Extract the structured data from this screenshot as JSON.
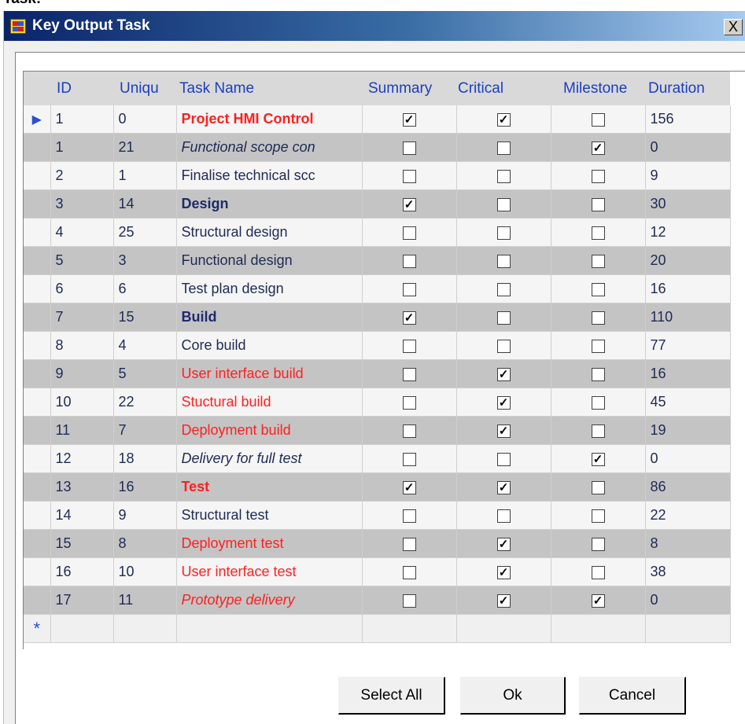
{
  "caption": "Task:",
  "window": {
    "title": "Key Output Task",
    "close_label": "X"
  },
  "grid": {
    "columns": [
      "ID",
      "Uniqu",
      "Task Name",
      "Summary",
      "Critical",
      "Milestone",
      "Duration"
    ],
    "current_row_marker": "▶",
    "new_row_marker": "*",
    "rows": [
      {
        "id": "1",
        "uid": "0",
        "name": "Project HMI Control",
        "style": "bold-red",
        "summary": true,
        "critical": true,
        "milestone": false,
        "duration": "156"
      },
      {
        "id": "1",
        "uid": "21",
        "name": "Functional scope con",
        "style": "italic",
        "summary": false,
        "critical": false,
        "milestone": true,
        "duration": "0"
      },
      {
        "id": "2",
        "uid": "1",
        "name": "Finalise technical scc",
        "style": "normal",
        "summary": false,
        "critical": false,
        "milestone": false,
        "duration": "9"
      },
      {
        "id": "3",
        "uid": "14",
        "name": "Design",
        "style": "bold-blue",
        "summary": true,
        "critical": false,
        "milestone": false,
        "duration": "30"
      },
      {
        "id": "4",
        "uid": "25",
        "name": "Structural design",
        "style": "normal",
        "summary": false,
        "critical": false,
        "milestone": false,
        "duration": "12"
      },
      {
        "id": "5",
        "uid": "3",
        "name": "Functional design",
        "style": "normal",
        "summary": false,
        "critical": false,
        "milestone": false,
        "duration": "20"
      },
      {
        "id": "6",
        "uid": "6",
        "name": "Test plan design",
        "style": "normal",
        "summary": false,
        "critical": false,
        "milestone": false,
        "duration": "16"
      },
      {
        "id": "7",
        "uid": "15",
        "name": "Build",
        "style": "bold-blue",
        "summary": true,
        "critical": false,
        "milestone": false,
        "duration": "110"
      },
      {
        "id": "8",
        "uid": "4",
        "name": "Core build",
        "style": "normal",
        "summary": false,
        "critical": false,
        "milestone": false,
        "duration": "77"
      },
      {
        "id": "9",
        "uid": "5",
        "name": "User interface build",
        "style": "red",
        "summary": false,
        "critical": true,
        "milestone": false,
        "duration": "16"
      },
      {
        "id": "10",
        "uid": "22",
        "name": "Stuctural build",
        "style": "red",
        "summary": false,
        "critical": true,
        "milestone": false,
        "duration": "45"
      },
      {
        "id": "11",
        "uid": "7",
        "name": "Deployment build",
        "style": "red",
        "summary": false,
        "critical": true,
        "milestone": false,
        "duration": "19"
      },
      {
        "id": "12",
        "uid": "18",
        "name": "Delivery for full test",
        "style": "italic",
        "summary": false,
        "critical": false,
        "milestone": true,
        "duration": "0"
      },
      {
        "id": "13",
        "uid": "16",
        "name": "Test",
        "style": "bold-red",
        "summary": true,
        "critical": true,
        "milestone": false,
        "duration": "86"
      },
      {
        "id": "14",
        "uid": "9",
        "name": "Structural test",
        "style": "normal",
        "summary": false,
        "critical": false,
        "milestone": false,
        "duration": "22"
      },
      {
        "id": "15",
        "uid": "8",
        "name": "Deployment test",
        "style": "red",
        "summary": false,
        "critical": true,
        "milestone": false,
        "duration": "8"
      },
      {
        "id": "16",
        "uid": "10",
        "name": "User interface test",
        "style": "red",
        "summary": false,
        "critical": true,
        "milestone": false,
        "duration": "38"
      },
      {
        "id": "17",
        "uid": "11",
        "name": "Prototype delivery",
        "style": "italic-red",
        "summary": false,
        "critical": true,
        "milestone": true,
        "duration": "0"
      }
    ]
  },
  "buttons": {
    "select_all": "Select All",
    "ok": "Ok",
    "cancel": "Cancel"
  }
}
